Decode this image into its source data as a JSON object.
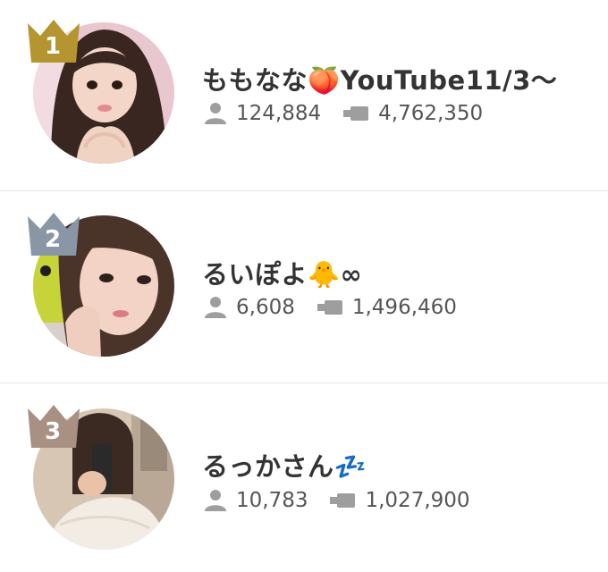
{
  "ranking": [
    {
      "rank": "1",
      "name": "ももなな🍑YouTube11/3〜",
      "followers": "124,884",
      "views": "4,762,350",
      "crown_color": "#b5952f",
      "crown_icon": "crown-icon",
      "follower_icon": "person-icon",
      "views_icon": "video-camera-icon"
    },
    {
      "rank": "2",
      "name": "るいぽよ🐥∞",
      "followers": "6,608",
      "views": "1,496,460",
      "crown_color": "#8996a6",
      "crown_icon": "crown-icon",
      "follower_icon": "person-icon",
      "views_icon": "video-camera-icon"
    },
    {
      "rank": "3",
      "name": "るっかさん💤",
      "followers": "10,783",
      "views": "1,027,900",
      "crown_color": "#a89082",
      "crown_icon": "crown-icon",
      "follower_icon": "person-icon",
      "views_icon": "video-camera-icon"
    }
  ],
  "colors": {
    "text": "#333333",
    "stat_text": "#555555",
    "icon_gray": "#9e9e9e",
    "divider": "#e6e6e6"
  }
}
